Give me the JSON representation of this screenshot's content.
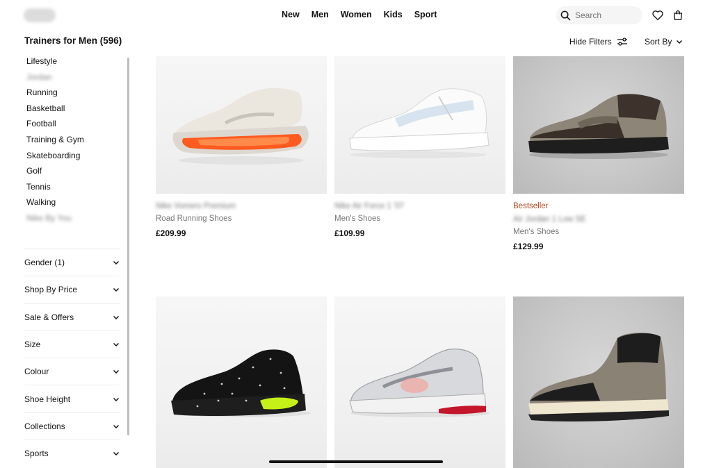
{
  "header": {
    "nav": [
      "New",
      "Men",
      "Women",
      "Kids",
      "Sport"
    ],
    "search": {
      "placeholder": "Search",
      "icon": "search-icon"
    },
    "icons": {
      "favourites": "heart-icon",
      "bag": "bag-icon"
    }
  },
  "page": {
    "title": "Trainers for Men (596)",
    "filter_label": "Hide Filters",
    "sort_label": "Sort By"
  },
  "sidebar": {
    "categories": [
      {
        "label": "Lifestyle",
        "blurred": false
      },
      {
        "label": "Jordan",
        "blurred": true
      },
      {
        "label": "Running",
        "blurred": false
      },
      {
        "label": "Basketball",
        "blurred": false
      },
      {
        "label": "Football",
        "blurred": false
      },
      {
        "label": "Training & Gym",
        "blurred": false
      },
      {
        "label": "Skateboarding",
        "blurred": false
      },
      {
        "label": "Golf",
        "blurred": false
      },
      {
        "label": "Tennis",
        "blurred": false
      },
      {
        "label": "Walking",
        "blurred": false
      },
      {
        "label": "Nike By You",
        "blurred": true
      }
    ],
    "filters": [
      "Gender (1)",
      "Shop By Price",
      "Sale & Offers",
      "Size",
      "Colour",
      "Shoe Height",
      "Collections",
      "Sports"
    ]
  },
  "products": [
    {
      "badge": "",
      "name": "Nike Vomero Premium",
      "type": "Road Running Shoes",
      "price": "£209.99"
    },
    {
      "badge": "",
      "name": "Nike Air Force 1 '07",
      "type": "Men's Shoes",
      "price": "£109.99"
    },
    {
      "badge": "Bestseller",
      "name": "Air Jordan 1 Low SE",
      "type": "Men's Shoes",
      "price": "£129.99"
    },
    {
      "badge": "",
      "name": "",
      "type": "",
      "price": ""
    },
    {
      "badge": "",
      "name": "",
      "type": "",
      "price": ""
    },
    {
      "badge": "",
      "name": "",
      "type": "",
      "price": ""
    }
  ],
  "colors": {
    "badge": "#b5451b",
    "text": "#111111",
    "muted": "#757575"
  }
}
